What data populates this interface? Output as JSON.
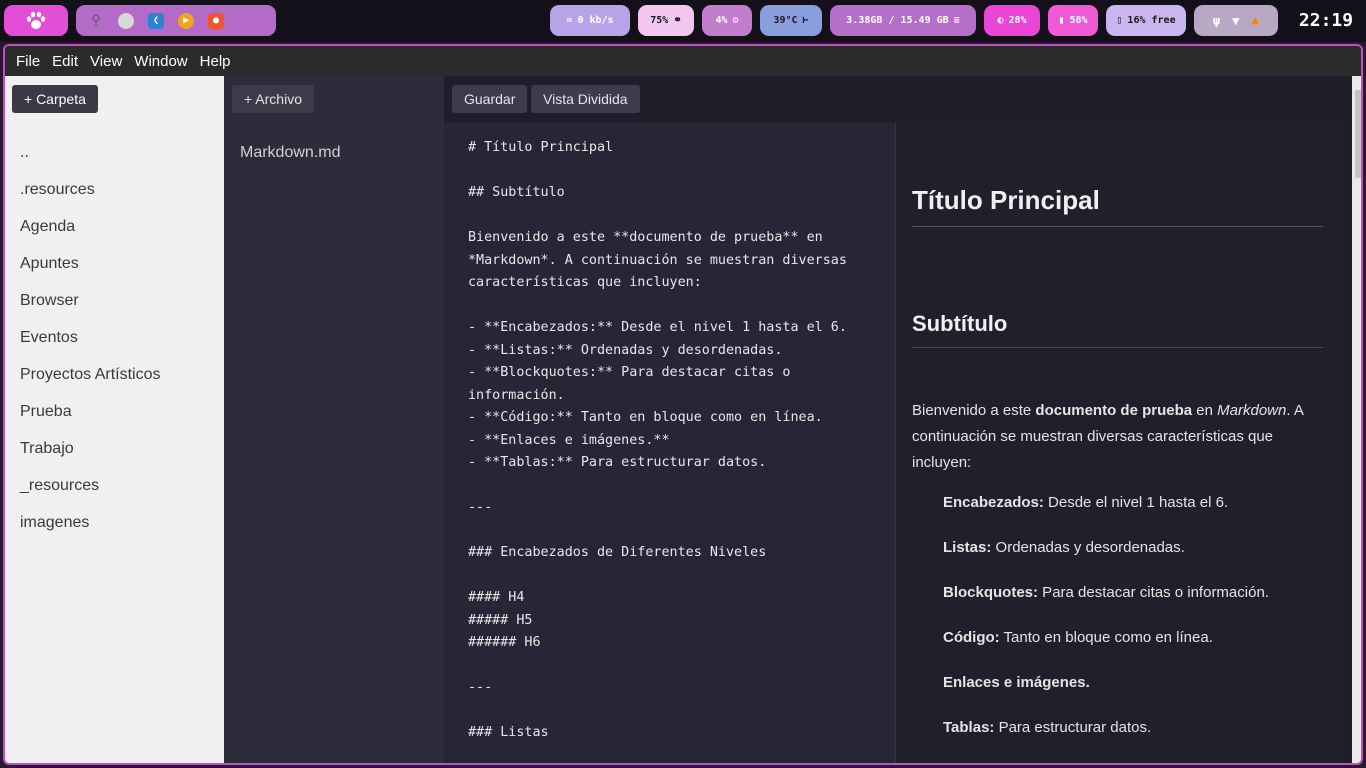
{
  "topbar": {
    "network": "0 kb/s",
    "volume": "75%",
    "cpu": "4%",
    "temperature": "39°C",
    "memory": "3.38GB / 15.49 GB",
    "brightness": "28%",
    "battery": "58%",
    "disk": "16% free",
    "clock": "22:19"
  },
  "menubar": {
    "file": "File",
    "edit": "Edit",
    "view": "View",
    "window": "Window",
    "help": "Help"
  },
  "folders": {
    "add_button": "+ Carpeta",
    "items": [
      "..",
      ".resources",
      "Agenda",
      "Apuntes",
      "Browser",
      "Eventos",
      "Proyectos Artísticos",
      "Prueba",
      "Trabajo",
      "_resources",
      "imagenes"
    ]
  },
  "files": {
    "add_button": "+ Archivo",
    "items": [
      "Markdown.md"
    ]
  },
  "toolbar": {
    "save": "Guardar",
    "split_view": "Vista Dividida"
  },
  "editor": {
    "lines": [
      "# Título Principal",
      "",
      "## Subtítulo",
      "",
      "Bienvenido a este **documento de prueba** en",
      "*Markdown*. A continuación se muestran diversas",
      "características que incluyen:",
      "",
      "- **Encabezados:** Desde el nivel 1 hasta el 6.",
      "- **Listas:** Ordenadas y desordenadas.",
      "- **Blockquotes:** Para destacar citas o",
      "información.",
      "- **Código:** Tanto en bloque como en línea.",
      "- **Enlaces e imágenes.**",
      "- **Tablas:** Para estructurar datos.",
      "",
      "---",
      "",
      "### Encabezados de Diferentes Niveles",
      "",
      "#### H4",
      "##### H5",
      "###### H6",
      "",
      "---",
      "",
      "### Listas"
    ]
  },
  "preview": {
    "h1": "Título Principal",
    "h2": "Subtítulo",
    "intro_pre": "Bienvenido a este ",
    "intro_bold": "documento de prueba",
    "intro_mid": " en ",
    "intro_em": "Markdown",
    "intro_post": ". A continuación se muestran diversas características que incluyen:",
    "list": [
      {
        "label": "Encabezados:",
        "text": " Desde el nivel 1 hasta el 6."
      },
      {
        "label": "Listas:",
        "text": " Ordenadas y desordenadas."
      },
      {
        "label": "Blockquotes:",
        "text": " Para destacar citas o información."
      },
      {
        "label": "Código:",
        "text": " Tanto en bloque como en línea."
      },
      {
        "label": "Enlaces e imágenes.",
        "text": ""
      },
      {
        "label": "Tablas:",
        "text": " Para estructurar datos."
      }
    ]
  }
}
